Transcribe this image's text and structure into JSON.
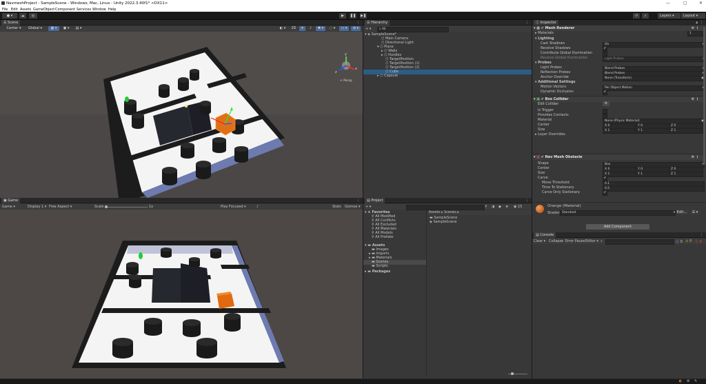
{
  "title": "NavmeshProject - SampleScene - Windows, Mac, Linux - Unity 2022.3.40f1* <DX11>",
  "menu": [
    "File",
    "Edit",
    "Assets",
    "GameObject",
    "Component",
    "Services",
    "Window",
    "Help"
  ],
  "toolbar": {
    "layers": "Layers",
    "layout": "Layout"
  },
  "scene": {
    "tab": "Scene",
    "pivot": "Center",
    "space": "Global",
    "view": "2D",
    "persp": "< Persp",
    "axes": {
      "x": "x",
      "y": "y",
      "z": "z"
    }
  },
  "game": {
    "tab": "Game",
    "mode": "Game",
    "display": "Display 1",
    "aspect": "Free Aspect",
    "scale_label": "Scale",
    "scale_value": "1x",
    "play_focused": "Play Focused",
    "stats": "Stats",
    "gizmos": "Gizmos"
  },
  "hierarchy": {
    "tab": "Hierarchy",
    "search": "All",
    "items": [
      {
        "label": "SampleScene*",
        "depth": 0,
        "arrow": "▾",
        "selected": false
      },
      {
        "label": "Main Camera",
        "depth": 1,
        "arrow": "",
        "selected": false
      },
      {
        "label": "Directional Light",
        "depth": 1,
        "arrow": "",
        "selected": false
      },
      {
        "label": "Plane",
        "depth": 1,
        "arrow": "▸",
        "selected": false
      },
      {
        "label": "Walls",
        "depth": 2,
        "arrow": "▸",
        "selected": false
      },
      {
        "label": "Hurdles",
        "depth": 2,
        "arrow": "▸",
        "selected": false
      },
      {
        "label": "TargetPosition",
        "depth": 2,
        "arrow": "",
        "selected": false
      },
      {
        "label": "TargetPosition (1)",
        "depth": 2,
        "arrow": "",
        "selected": false
      },
      {
        "label": "TargetPosition (2)",
        "depth": 2,
        "arrow": "",
        "selected": false
      },
      {
        "label": "Cube",
        "depth": 2,
        "arrow": "",
        "selected": true
      },
      {
        "label": "Capsule",
        "depth": 1,
        "arrow": "▸",
        "selected": false
      }
    ]
  },
  "project": {
    "tab": "Project",
    "favorites_label": "Favorites",
    "favorites": [
      "All Modified",
      "All Conflicts",
      "All Excluded",
      "All Materials",
      "All Models",
      "All Prefabs"
    ],
    "assets_label": "Assets",
    "assets": [
      "Images",
      "Imports",
      "Materials",
      "Scenes",
      "Scripts"
    ],
    "packages_label": "Packages",
    "breadcrumb": [
      "Assets",
      "Scenes"
    ],
    "files": [
      {
        "name": "SampleScene",
        "kind": "folder"
      },
      {
        "name": "SampleScene",
        "kind": "scene"
      }
    ],
    "count": "15"
  },
  "inspector": {
    "tab": "Inspector",
    "mesh_renderer": "Mesh Renderer",
    "materials_label": "Materials",
    "materials_count": "1",
    "lighting": "Lighting",
    "cast_shadows": "Cast Shadows",
    "cast_shadows_val": "On",
    "receive_shadows": "Receive Shadows",
    "contribute_gi": "Contribute Global Illumination",
    "receive_gi": "Receive Global Illumination",
    "receive_gi_val": "Light Probes",
    "probes": "Probes",
    "light_probes": "Light Probes",
    "light_probes_val": "Blend Probes",
    "reflection_probes": "Reflection Probes",
    "reflection_probes_val": "Blend Probes",
    "anchor_override": "Anchor Override",
    "anchor_override_val": "None (Transform)",
    "additional": "Additional Settings",
    "motion_vectors": "Motion Vectors",
    "motion_vectors_val": "Per Object Motion",
    "dynamic_occlusion": "Dynamic Occlusion",
    "box_collider": "Box Collider",
    "edit_collider": "Edit Collider",
    "is_trigger": "Is Trigger",
    "provides_contacts": "Provides Contacts",
    "material": "Material",
    "material_val": "None (Physic Material)",
    "center": "Center",
    "size": "Size",
    "bc_center": {
      "x": "0",
      "y": "0",
      "z": "0"
    },
    "bc_size": {
      "x": "1",
      "y": "1",
      "z": "1"
    },
    "layer_overrides": "Layer Overrides",
    "nav_obstacle": "Nav Mesh Obstacle",
    "shape": "Shape",
    "shape_val": "Box",
    "nmo_center": {
      "x": "0",
      "y": "0",
      "z": "0"
    },
    "nmo_size": {
      "x": "1",
      "y": "1",
      "z": "1"
    },
    "carve": "Carve",
    "move_threshold": "Move Threshold",
    "move_threshold_val": "0.1",
    "time_to_stationary": "Time To Stationary",
    "time_to_stationary_val": "0.5",
    "carve_only_stationary": "Carve Only Stationary",
    "material_name": "Orange (Material)",
    "shader_label": "Shader",
    "shader_val": "Standard",
    "edit": "Edit...",
    "add_component": "Add Component"
  },
  "console": {
    "tab": "Console",
    "clear": "Clear",
    "collapse": "Collapse",
    "error_pause": "Error Pause",
    "editor": "Editor",
    "counts": {
      "info": "0",
      "warn": "0",
      "error": "0"
    }
  }
}
